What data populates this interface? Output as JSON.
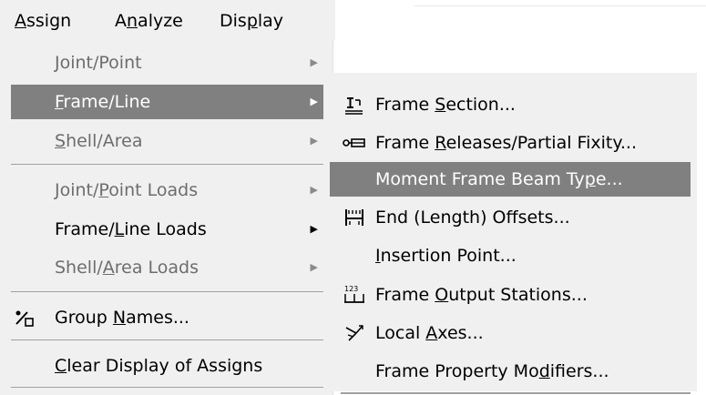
{
  "menubar": {
    "items": [
      {
        "text": "Assign",
        "mnemonic_index": 0
      },
      {
        "text": "Analyze",
        "mnemonic_index": 1
      },
      {
        "text": "Display",
        "mnemonic_index": 3
      }
    ]
  },
  "assign_menu": {
    "items": [
      {
        "label": "Joint/Point",
        "mn": 0,
        "enabled": false,
        "submenu": true
      },
      {
        "label": "Frame/Line",
        "mn": 0,
        "enabled": true,
        "highlighted": true,
        "submenu": true
      },
      {
        "label": "Shell/Area",
        "mn": 0,
        "enabled": false,
        "submenu": true
      },
      {
        "label": "Joint/Point Loads",
        "mn": 6,
        "enabled": false,
        "submenu": true
      },
      {
        "label": "Frame/Line Loads",
        "mn": 6,
        "enabled": true,
        "submenu": true
      },
      {
        "label": "Shell/Area Loads",
        "mn": 6,
        "enabled": false,
        "submenu": true
      },
      {
        "label": "Group Names...",
        "mn": 6,
        "enabled": true,
        "icon": "group-names-icon"
      },
      {
        "label": "Clear Display of Assigns",
        "mn": 0,
        "enabled": true
      }
    ]
  },
  "frame_submenu": {
    "items": [
      {
        "label": "Frame Section...",
        "mn": 6,
        "icon": "frame-section-icon"
      },
      {
        "label": "Frame Releases/Partial Fixity...",
        "mn": 6,
        "icon": "frame-releases-icon"
      },
      {
        "label": "Moment Frame Beam Type...",
        "mn": 20,
        "highlighted": true
      },
      {
        "label": "End (Length) Offsets...",
        "mn": 15,
        "icon": "end-offsets-icon"
      },
      {
        "label": "Insertion Point...",
        "mn": 0
      },
      {
        "label": "Frame Output Stations...",
        "mn": 6,
        "icon": "output-stations-icon"
      },
      {
        "label": "Local Axes...",
        "mn": 6,
        "icon": "local-axes-icon"
      },
      {
        "label": "Frame Property Modifiers...",
        "mn": 17
      }
    ]
  },
  "colors": {
    "menu_bg": "#f0f0f0",
    "highlight": "#808080",
    "disabled_text": "#6d6d6d"
  }
}
